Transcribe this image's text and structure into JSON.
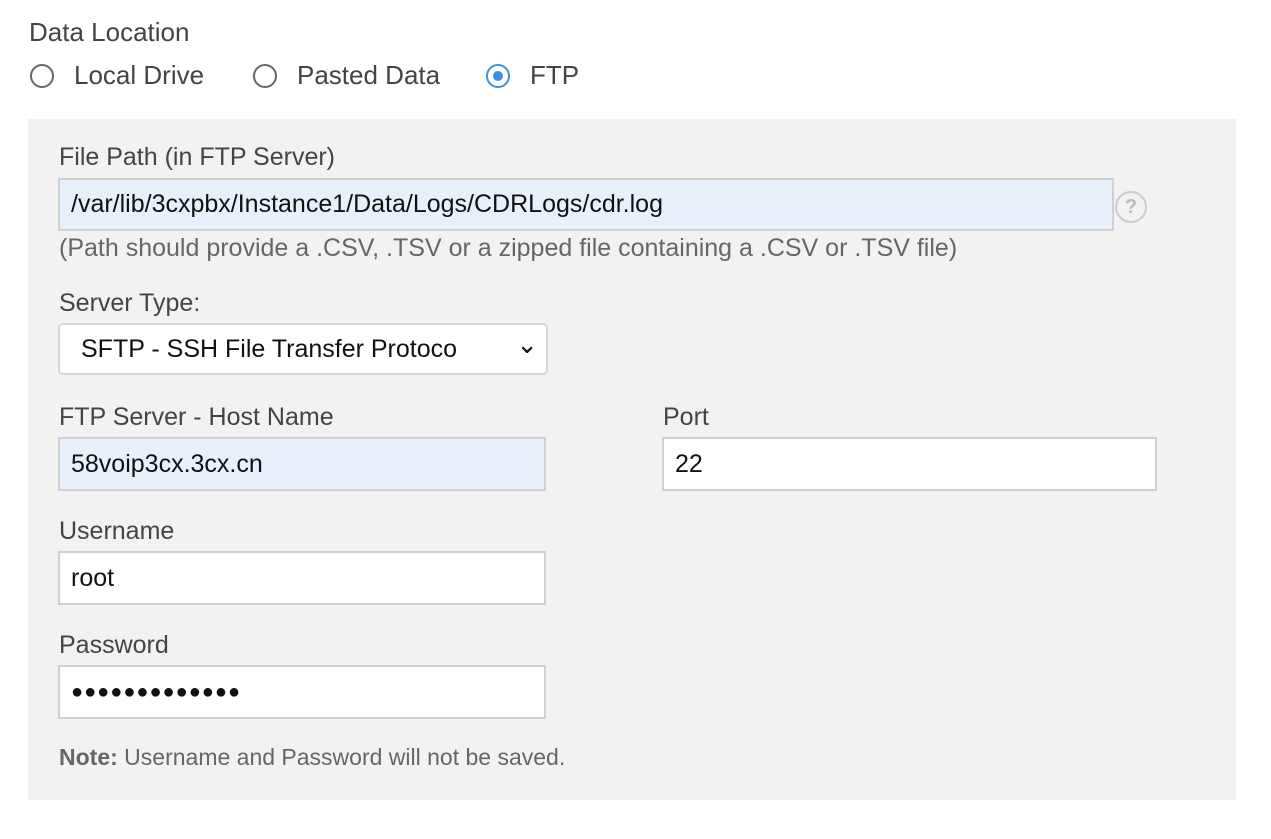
{
  "data_location": {
    "label": "Data Location",
    "options": [
      {
        "label": "Local Drive",
        "selected": false
      },
      {
        "label": "Pasted Data",
        "selected": false
      },
      {
        "label": "FTP",
        "selected": true
      }
    ]
  },
  "file_path": {
    "label": "File Path (in FTP Server)",
    "value": "/var/lib/3cxpbx/Instance1/Data/Logs/CDRLogs/cdr.log",
    "help": "?",
    "hint": "(Path should provide a .CSV, .TSV or a zipped file containing a .CSV or .TSV file)"
  },
  "server_type": {
    "label": "Server Type:",
    "value": "SFTP - SSH File Transfer Protoco",
    "chevron": "⌄"
  },
  "host": {
    "label": "FTP Server - Host Name",
    "value": "58voip3cx.3cx.cn"
  },
  "port": {
    "label": "Port",
    "value": "22"
  },
  "username": {
    "label": "Username",
    "value": "root"
  },
  "password": {
    "label": "Password",
    "value": "●●●●●●●●●●●●●"
  },
  "note": {
    "bold": "Note:",
    "text": " Username and Password will not be saved."
  },
  "colors": {
    "accent": "#3d8fe0",
    "panel": "#f2f2f2",
    "autofill": "#e8f0fc"
  }
}
